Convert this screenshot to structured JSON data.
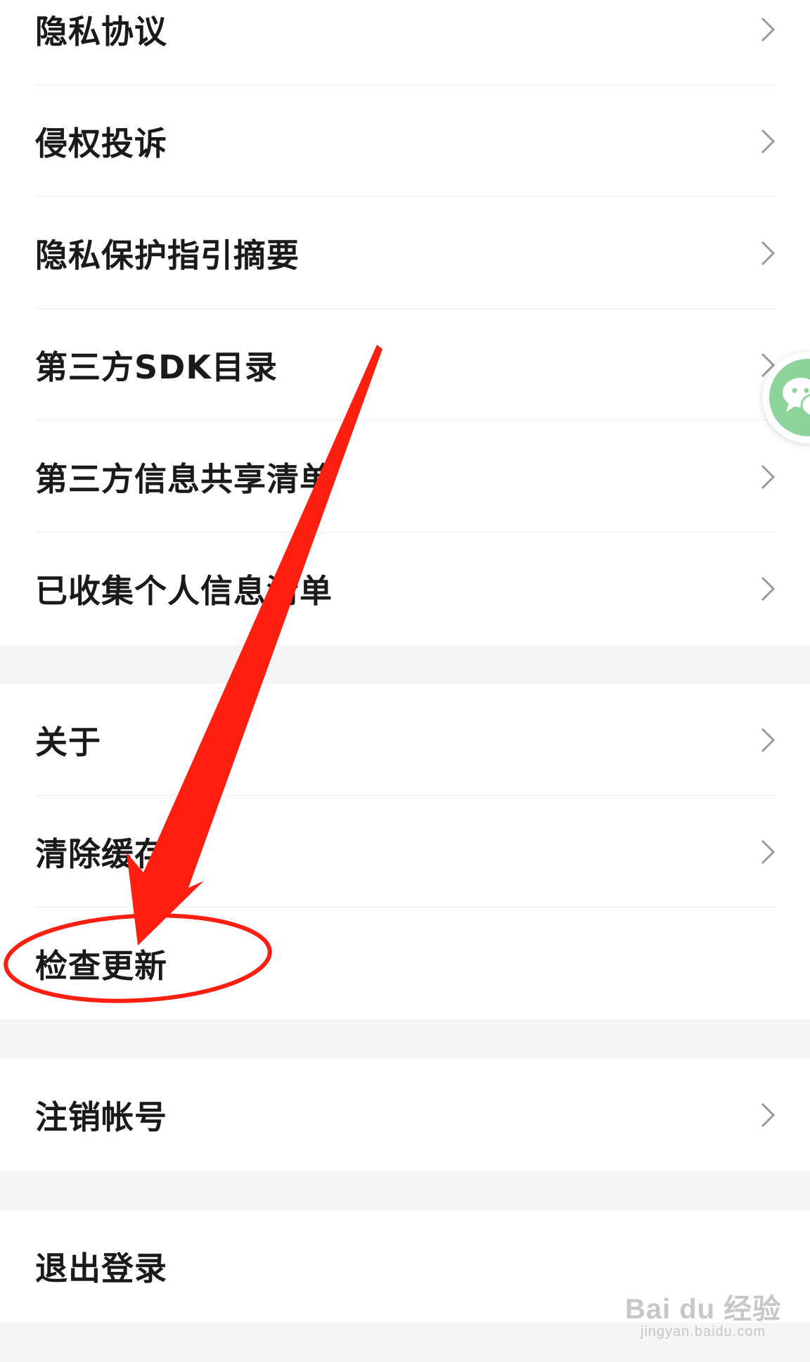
{
  "settings": {
    "group1": [
      {
        "label": "隐私协议",
        "chevron": "chevron-right-icon"
      },
      {
        "label": "侵权投诉",
        "chevron": "chevron-right-icon"
      },
      {
        "label": "隐私保护指引摘要",
        "chevron": "chevron-right-icon"
      },
      {
        "label": "第三方SDK目录",
        "chevron": "chevron-right-icon"
      },
      {
        "label": "第三方信息共享清单",
        "chevron": "chevron-right-icon"
      },
      {
        "label": "已收集个人信息清单",
        "chevron": "chevron-right-icon"
      }
    ],
    "group2": [
      {
        "label": "关于",
        "chevron": "chevron-right-icon"
      },
      {
        "label": "清除缓存",
        "chevron": "chevron-right-icon"
      },
      {
        "label": "检查更新"
      }
    ],
    "group3": [
      {
        "label": "注销帐号",
        "chevron": "chevron-right-icon"
      }
    ],
    "group4": [
      {
        "label": "退出登录"
      }
    ]
  },
  "floating_button": {
    "icon": "wechat-icon",
    "color": "#8ed39a"
  },
  "annotation": {
    "arrow_color": "#ff1f10",
    "circle_color": "#ff1f10",
    "highlight_target": "检查更新"
  },
  "watermark": {
    "main": "Bai du 经验",
    "sub": "jingyan.baidu.com"
  },
  "colors": {
    "background": "#f5f5f5",
    "card": "#ffffff",
    "text": "#1a1a1a",
    "chevron": "#9a9a9a"
  }
}
